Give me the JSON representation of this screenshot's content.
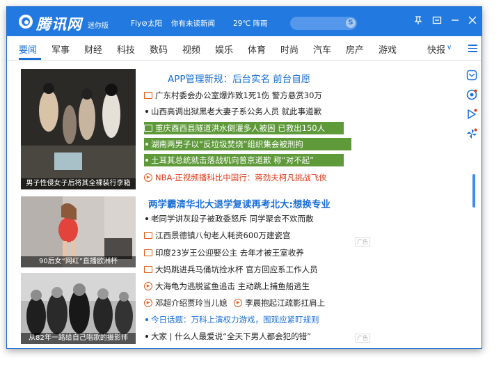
{
  "app": {
    "logo_text": "腾讯网",
    "mini_tag": "迷你版",
    "user": "Fly⊘太阳",
    "unread": "你有未读新闻",
    "weather": "29℃ 阵雨",
    "search_icon_letter": "S"
  },
  "nav": {
    "items": [
      "要闻",
      "军事",
      "财经",
      "科技",
      "数码",
      "视频",
      "娱乐",
      "体育",
      "时尚",
      "汽车",
      "房产",
      "游戏"
    ],
    "express": "快报",
    "express_arrow": "∨"
  },
  "photos": [
    {
      "caption": "男子性侵女子后将其全裸装行李箱"
    },
    {
      "caption": "90后女“网红”直播欧洲杯"
    },
    {
      "caption": "从82年一路给自己唱歌的摄影师"
    }
  ],
  "headlines": {
    "top": "APP管理新规：后台实名 前台自愿",
    "second": "两学霸清华北大退学复读再考北大:想换专业"
  },
  "news_block1": [
    {
      "icon": "picture",
      "text": "广东村委会办公室爆炸致1死1伤 警方悬赏30万",
      "style": "normal"
    },
    {
      "icon": "bullet",
      "text": "山西高调出狱黑老大妻子系公务人员 就此事道歉",
      "style": "normal"
    },
    {
      "icon": "picture",
      "text": "重庆酉西县隧道洪水倒灌多人被困 已救出150人",
      "style": "selected"
    },
    {
      "icon": "bullet",
      "text": "湖南两男子以“反垃圾焚烧”组织集会被刑拘",
      "style": "selected"
    },
    {
      "icon": "bullet",
      "text": "土耳其总统就击落战机向普京道歉 称“对不起”",
      "style": "selected"
    },
    {
      "icon": "video",
      "text": "NBA-正视频播科比中国行：蒋劲夫柯凡挑战飞侠",
      "style": "red"
    }
  ],
  "news_block2": [
    {
      "icon": "bullet",
      "text": "老同学讲灰段子被政委怒斥 同学聚会不欢而散",
      "style": "normal"
    },
    {
      "icon": "picture",
      "text": "江西景德镇八旬老人耗资600万建瓷宫",
      "style": "normal",
      "ad": "广告"
    },
    {
      "icon": "picture",
      "text": "印度23岁王公迎娶公主 去年才被王室收养",
      "style": "normal"
    },
    {
      "icon": "picture",
      "text": "大妈跳进兵马俑坑捡水杯 官方回应系工作人员",
      "style": "normal"
    },
    {
      "icon": "video",
      "text": "大海龟为逃脱鲨鱼追击 主动跳上捕鱼船逃生",
      "style": "normal"
    },
    {
      "icon": "video",
      "text": "邓超介绍贾玲当儿媳",
      "text2": "李晨抱起江疏影扛肩上",
      "style": "double"
    },
    {
      "icon": "bullet",
      "text": "今日话题：万科上演权力游戏，围观应紧盯规则",
      "style": "blue"
    },
    {
      "icon": "bullet",
      "text": "大家 | 什么人最爱说“全天下男人都会犯的错”",
      "style": "normal",
      "ad": "广告"
    }
  ],
  "colors": {
    "brand": "#2279e0",
    "highlight": "#5f9a3a",
    "link": "#1a6fd4",
    "alert": "#e03b1b"
  }
}
